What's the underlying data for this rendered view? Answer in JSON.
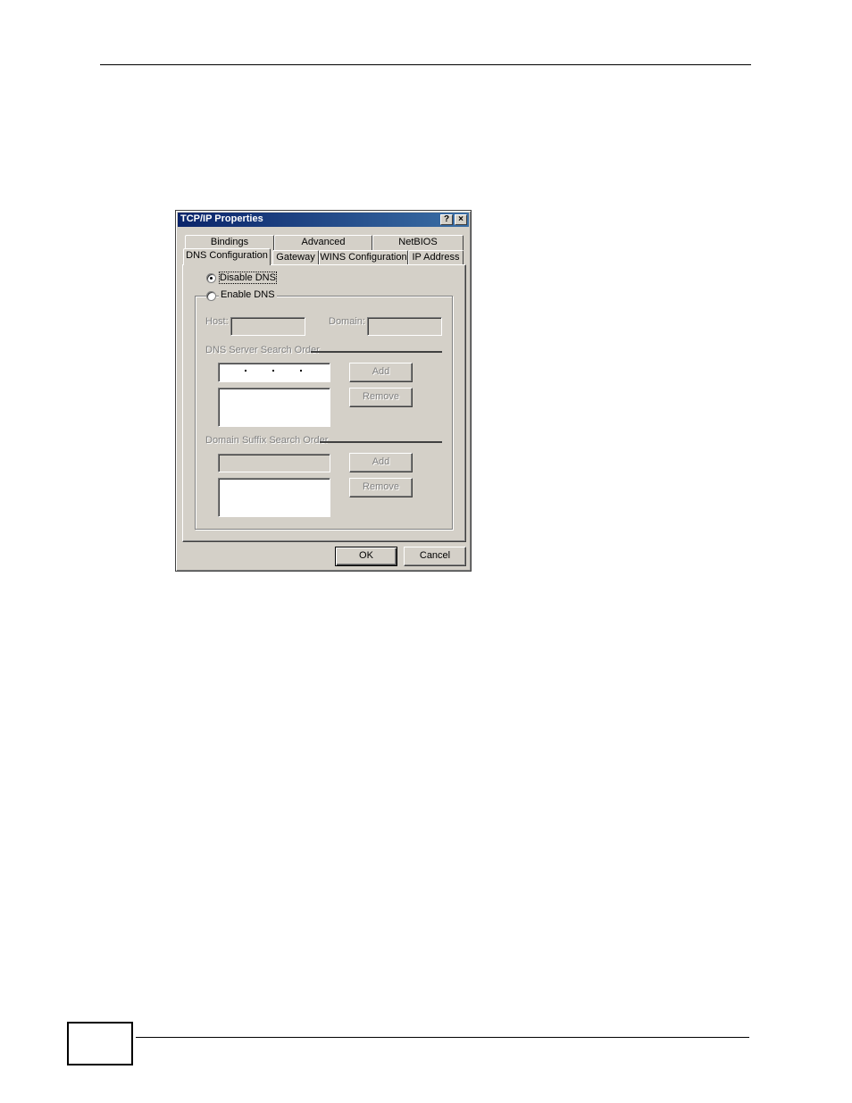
{
  "dialog": {
    "title": "TCP/IP Properties",
    "help_glyph": "?",
    "close_glyph": "×",
    "tabs_back": [
      "Bindings",
      "Advanced",
      "NetBIOS"
    ],
    "tabs_front": [
      "DNS Configuration",
      "Gateway",
      "WINS Configuration",
      "IP Address"
    ],
    "active_tab": "DNS Configuration",
    "disable_dns_label": "Disable DNS",
    "enable_dns_label": "Enable DNS",
    "selected_option": "Disable DNS",
    "host_label": "Host:",
    "host_value": "",
    "domain_label": "Domain:",
    "domain_value": "",
    "dns_group_label": "DNS Server Search Order",
    "dns_ip_value": "",
    "dns_add_label": "Add",
    "dns_remove_label": "Remove",
    "suffix_group_label": "Domain Suffix Search Order",
    "suffix_value": "",
    "suffix_add_label": "Add",
    "suffix_remove_label": "Remove",
    "ok_label": "OK",
    "cancel_label": "Cancel"
  }
}
